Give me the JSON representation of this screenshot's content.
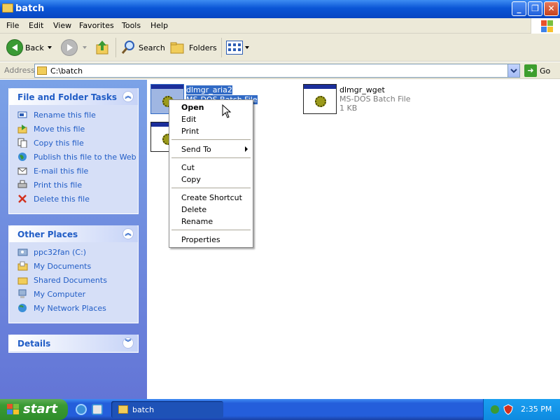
{
  "window": {
    "title": "batch"
  },
  "menubar": {
    "items": [
      "File",
      "Edit",
      "View",
      "Favorites",
      "Tools",
      "Help"
    ]
  },
  "toolbar": {
    "back": "Back",
    "search": "Search",
    "folders": "Folders"
  },
  "address": {
    "label": "Address",
    "value": "C:\\batch",
    "go": "Go"
  },
  "tasks": {
    "title": "File and Folder Tasks",
    "items": [
      "Rename this file",
      "Move this file",
      "Copy this file",
      "Publish this file to the Web",
      "E-mail this file",
      "Print this file",
      "Delete this file"
    ]
  },
  "other_places": {
    "title": "Other Places",
    "items": [
      "ppc32fan (C:)",
      "My Documents",
      "Shared Documents",
      "My Computer",
      "My Network Places"
    ]
  },
  "details": {
    "title": "Details"
  },
  "files": [
    {
      "name": "dlmgr_aria2",
      "type": "MS-DOS Batch File",
      "selected": true
    },
    {
      "name": "dlmgr_wget",
      "type": "MS-DOS Batch File",
      "size": "1 KB"
    },
    {
      "name": "",
      "type": ""
    }
  ],
  "context_menu": {
    "items": [
      "Open",
      "Edit",
      "Print",
      "Send To",
      "Cut",
      "Copy",
      "Create Shortcut",
      "Delete",
      "Rename",
      "Properties"
    ]
  },
  "taskbar": {
    "start": "start",
    "task": "batch",
    "clock": "2:35 PM"
  },
  "colors": {
    "xp_blue": "#0a55d6",
    "selection": "#316ac5",
    "task_text": "#215dc6",
    "start_green": "#3a9a34"
  }
}
